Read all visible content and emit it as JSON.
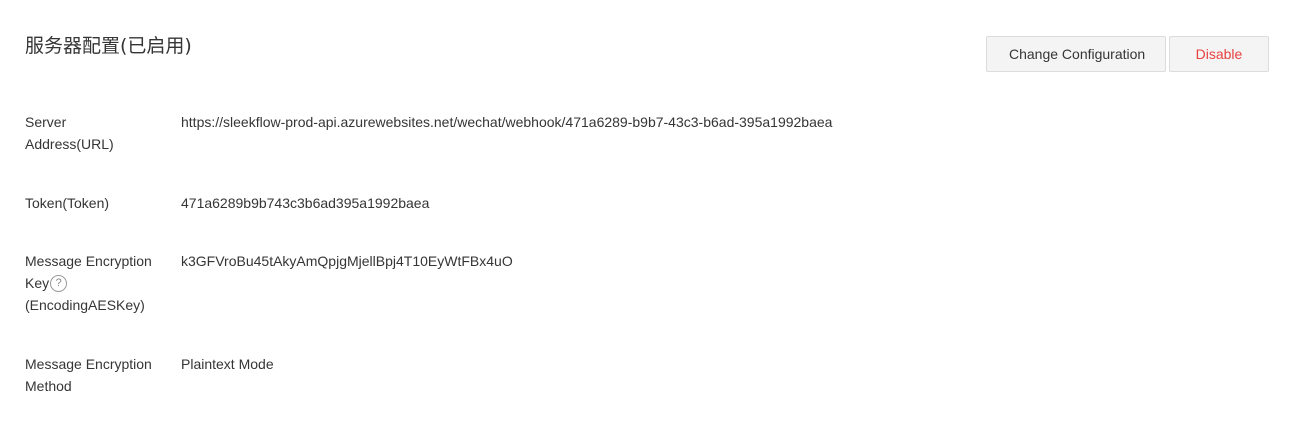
{
  "header": {
    "title": "服务器配置(已启用)"
  },
  "toolbar": {
    "change_label": "Change Configuration",
    "disable_label": "Disable"
  },
  "config": {
    "server_address": {
      "label_line1": "Server",
      "label_line2": "Address(URL)",
      "value": "https://sleekflow-prod-api.azurewebsites.net/wechat/webhook/471a6289-b9b7-43c3-b6ad-395a1992baea"
    },
    "token": {
      "label": "Token(Token)",
      "value": "471a6289b9b743c3b6ad395a1992baea"
    },
    "encoding_key": {
      "label_line1": "Message Encryption",
      "label_line2": "Key",
      "label_line3": "(EncodingAESKey)",
      "help_icon": "question-mark-circle",
      "help_glyph": "?",
      "value": "k3GFVroBu45tAkyAmQpjgMjellBpj4T10EyWtFBx4uO"
    },
    "encryption_method": {
      "label_line1": "Message Encryption",
      "label_line2": "Method",
      "value": "Plaintext Mode"
    }
  },
  "colors": {
    "text": "#353535",
    "danger": "#e64340",
    "button_bg": "#f4f4f4",
    "button_border": "#dcdcdc"
  }
}
